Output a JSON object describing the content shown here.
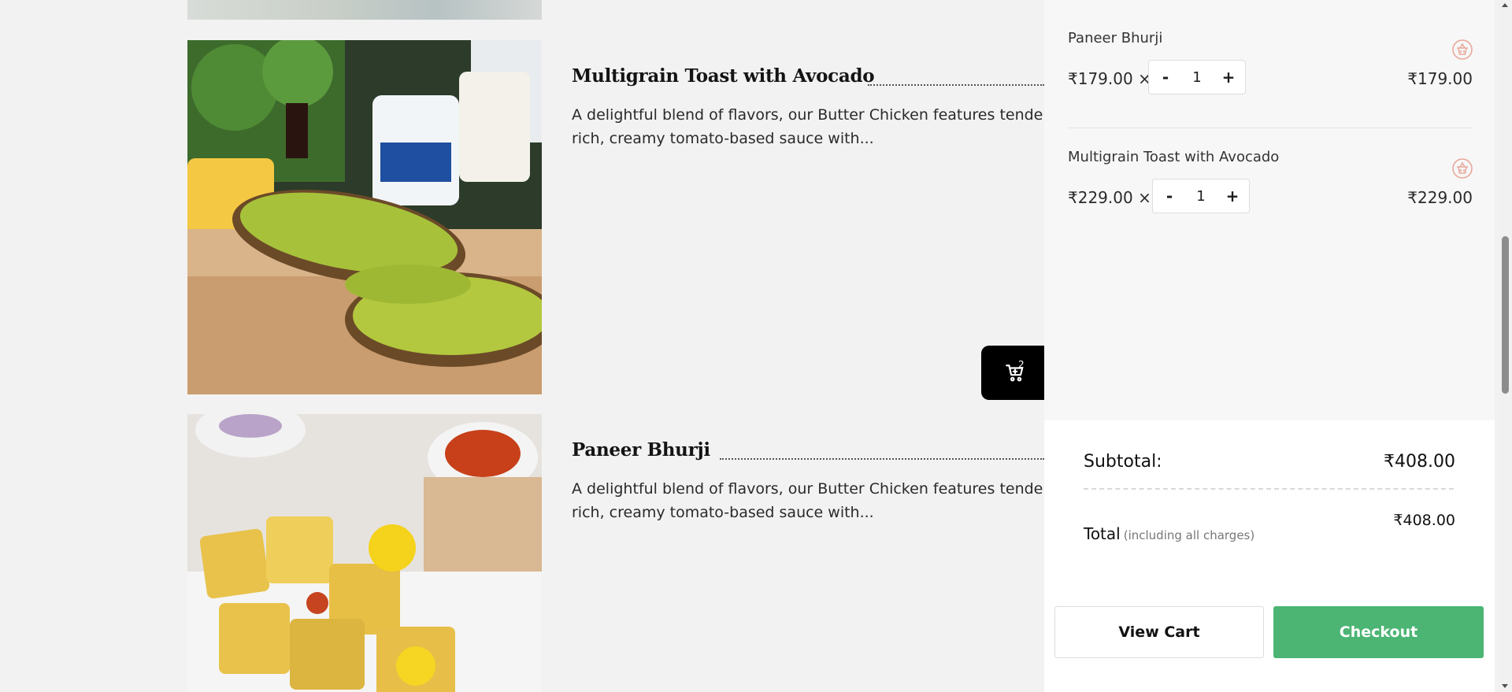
{
  "menu": {
    "items": [
      {
        "title": "Multigrain Toast with Avocado",
        "description_line1": "A delightful blend of flavors, our Butter Chicken features tender c",
        "description_line2": "rich, creamy tomato-based sauce with..."
      },
      {
        "title": "Paneer Bhurji",
        "description_line1": "A delightful blend of flavors, our Butter Chicken features tender c",
        "description_line2": "rich, creamy tomato-based sauce with..."
      }
    ],
    "cart_button": {
      "icon": "cart-icon",
      "count": "2"
    }
  },
  "cart": {
    "items": [
      {
        "name": "Paneer Bhurji",
        "unit_price": "₹179.00 × 1",
        "quantity": "1",
        "minus": "-",
        "plus": "+",
        "line_total": "₹179.00",
        "remove_icon": "trash-basket-icon"
      },
      {
        "name": "Multigrain Toast with Avocado",
        "unit_price": "₹229.00 × 1",
        "quantity": "1",
        "minus": "-",
        "plus": "+",
        "line_total": "₹229.00",
        "remove_icon": "trash-basket-icon"
      }
    ],
    "subtotal_label": "Subtotal:",
    "subtotal_value": "₹408.00",
    "total_label": "Total",
    "total_note": "(including all charges)",
    "total_value": "₹408.00",
    "view_cart_label": "View Cart",
    "checkout_label": "Checkout"
  },
  "colors": {
    "checkout": "#4cb574",
    "trash_icon": "#e8a89b",
    "fab": "#000000"
  }
}
